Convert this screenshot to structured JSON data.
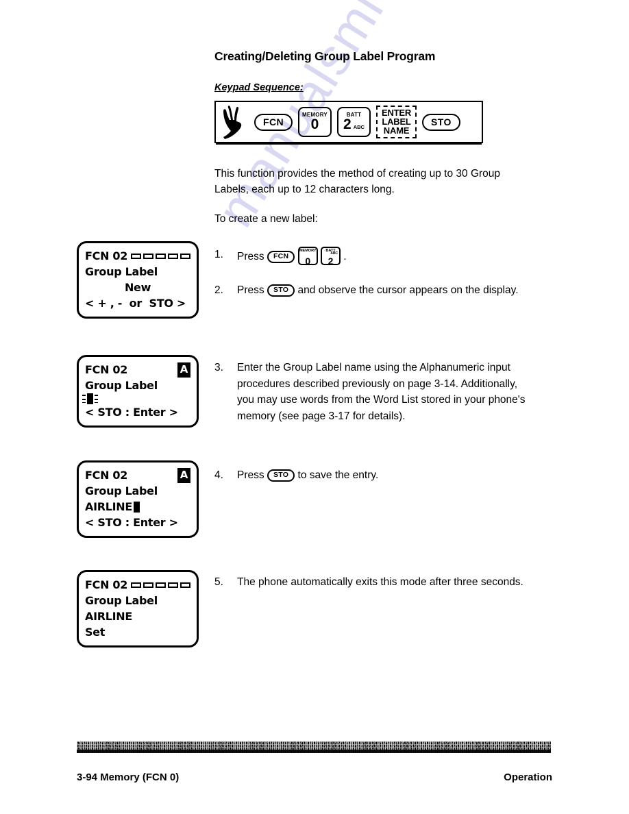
{
  "watermark": {
    "text": "manualsmive.com"
  },
  "section": {
    "title": "Creating/Deleting Group Label Program",
    "keypad_caption": "Keypad Sequence:"
  },
  "keypad_sequence": {
    "hand_icon": "pointing-hand-icon",
    "keys": [
      {
        "type": "pill",
        "label": "FCN"
      },
      {
        "type": "num",
        "sup": "MEMORY",
        "digit": "0",
        "abc": ""
      },
      {
        "type": "num",
        "sup": "BATT",
        "digit": "2",
        "abc": "ABC"
      },
      {
        "type": "dashed",
        "line1": "ENTER",
        "line2": "LABEL",
        "line3": "NAME"
      },
      {
        "type": "pill",
        "label": "STO"
      }
    ]
  },
  "body": {
    "intro": "This function provides the method of creating up to 30 Group Labels, each up to 12 characters long.",
    "intro2": "To create a new label:"
  },
  "displays": [
    {
      "name": "lcd-new-group-label",
      "line1": "FCN 02",
      "signal_bars": 5,
      "alpha_indicator": "",
      "line2": "Group Label",
      "line3": "New",
      "line4": "< + , -  or  STO >"
    },
    {
      "name": "lcd-cursor-empty",
      "line1": "FCN 02",
      "signal_bars": 0,
      "alpha_indicator": "A",
      "line2": "Group Label",
      "line3": "",
      "line4": "< STO : Enter >"
    },
    {
      "name": "lcd-airline-entry",
      "line1": "FCN 02",
      "signal_bars": 0,
      "alpha_indicator": "A",
      "line2": "Group Label",
      "line3": "AIRLINE",
      "line4": "< STO : Enter >"
    },
    {
      "name": "lcd-airline-set",
      "line1": "FCN 02",
      "signal_bars": 5,
      "alpha_indicator": "",
      "line2": "Group Label",
      "line3": "AIRLINE",
      "line4": "Set"
    }
  ],
  "steps": [
    {
      "number": "1.",
      "lead": "Press",
      "trail": ".",
      "keys": [
        {
          "type": "pill",
          "label": "FCN"
        },
        {
          "type": "num",
          "sup": "MEMORY",
          "digit": "0",
          "abc": ""
        },
        {
          "type": "num",
          "sup": "BATT",
          "digit": "2",
          "abc": "ABC"
        }
      ]
    },
    {
      "number": "2.",
      "lead": "Press",
      "trail": "and observe the cursor appears on the display.",
      "keys": [
        {
          "type": "pill",
          "label": "STO"
        }
      ]
    },
    {
      "number": "3.",
      "text": "Enter the Group Label name using the Alphanumeric input procedures described previously on page 3-14. Additionally, you may use words from the Word List stored in your phone's memory (see page 3-17 for details)."
    },
    {
      "number": "4.",
      "lead": "Press",
      "trail": "to save the entry.",
      "keys": [
        {
          "type": "pill",
          "label": "STO"
        }
      ]
    },
    {
      "number": "5.",
      "text": "The phone automatically exits this mode after three seconds."
    }
  ],
  "footer": {
    "left": "3-94  Memory (FCN 0)",
    "right": "Operation"
  }
}
